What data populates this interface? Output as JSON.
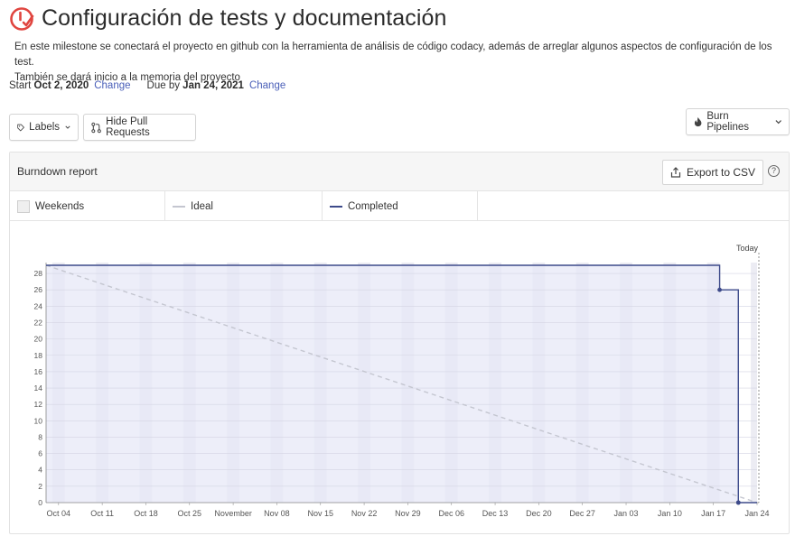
{
  "header": {
    "title": "Configuración de tests y documentación",
    "description_line1": "En este milestone se conectará el proyecto en github con la herramienta de análisis de código codacy, además de arreglar algunos aspectos de configuración de los test.",
    "description_line2": "También se dará inicio a la memoria del proyecto",
    "icon": "milestone-icon",
    "icon_color": "#e0453f"
  },
  "dates": {
    "start_label": "Start",
    "start_value": "Oct 2, 2020",
    "start_change": "Change",
    "due_label": "Due by",
    "due_value": "Jan 24, 2021",
    "due_change": "Change"
  },
  "toolbar": {
    "labels_button": "Labels",
    "hide_pr_button": "Hide Pull Requests",
    "burn_pipelines_button": "Burn Pipelines"
  },
  "report": {
    "title": "Burndown report",
    "export_button": "Export to CSV",
    "help_glyph": "?"
  },
  "legend": {
    "weekends": "Weekends",
    "ideal": "Ideal",
    "completed": "Completed"
  },
  "colors": {
    "accent": "#4a5fb8",
    "completed_line": "#3d4a8a",
    "completed_fill": "#e6e7f7",
    "ideal_line": "#c4c6d0",
    "weekend_band": "#d9dbeb"
  },
  "chart_data": {
    "type": "line",
    "today_label": "Today",
    "x_tick_labels": [
      "Oct 04",
      "Oct 11",
      "Oct 18",
      "Oct 25",
      "November",
      "Nov 08",
      "Nov 15",
      "Nov 22",
      "Nov 29",
      "Dec 06",
      "Dec 13",
      "Dec 20",
      "Dec 27",
      "Jan 03",
      "Jan 10",
      "Jan 17",
      "Jan 24"
    ],
    "y_ticks": [
      0,
      2,
      4,
      6,
      8,
      10,
      12,
      14,
      16,
      18,
      20,
      22,
      24,
      26,
      28
    ],
    "ylim": [
      0,
      29
    ],
    "x_start": "2020-10-02",
    "x_end": "2021-01-24",
    "today": "2021-01-24",
    "series": [
      {
        "name": "Ideal",
        "style": "dashed",
        "x": [
          "2020-10-02",
          "2021-01-24"
        ],
        "values": [
          29,
          0
        ]
      },
      {
        "name": "Completed",
        "style": "step",
        "x": [
          "2020-10-02",
          "2021-01-18",
          "2021-01-18",
          "2021-01-21",
          "2021-01-21",
          "2021-01-24"
        ],
        "values": [
          29,
          29,
          26,
          26,
          0,
          0
        ]
      }
    ]
  }
}
